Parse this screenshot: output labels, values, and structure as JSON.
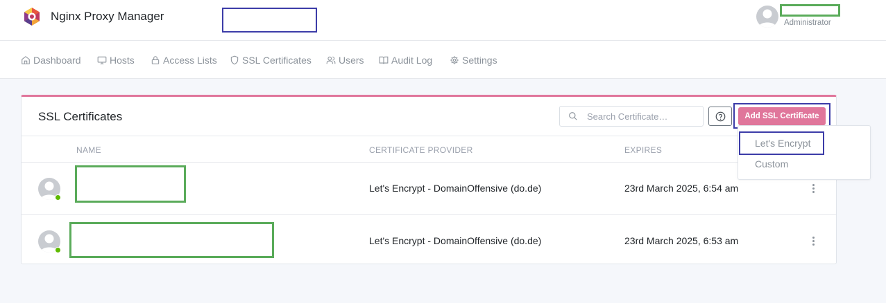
{
  "app": {
    "title": "Nginx Proxy Manager",
    "user_role": "Administrator"
  },
  "nav": [
    {
      "label": "Dashboard",
      "icon": "home-icon"
    },
    {
      "label": "Hosts",
      "icon": "monitor-icon"
    },
    {
      "label": "Access Lists",
      "icon": "lock-icon"
    },
    {
      "label": "SSL Certificates",
      "icon": "shield-icon"
    },
    {
      "label": "Users",
      "icon": "users-icon"
    },
    {
      "label": "Audit Log",
      "icon": "book-icon"
    },
    {
      "label": "Settings",
      "icon": "gear-icon"
    }
  ],
  "card": {
    "title": "SSL Certificates",
    "search_placeholder": "Search Certificate…",
    "add_button": "Add SSL Certificate"
  },
  "table": {
    "columns": [
      "NAME",
      "CERTIFICATE PROVIDER",
      "EXPIRES"
    ],
    "rows": [
      {
        "provider": "Let's Encrypt - DomainOffensive (do.de)",
        "expires": "23rd March 2025, 6:54 am"
      },
      {
        "provider": "Let's Encrypt - DomainOffensive (do.de)",
        "expires": "23rd March 2025, 6:53 am"
      }
    ]
  },
  "dropdown": {
    "items": [
      "Let's Encrypt",
      "Custom"
    ]
  },
  "colors": {
    "accent": "#e0769b",
    "annotation_redaction": "#5aab5a",
    "annotation_highlight": "#3c3ca8",
    "status_online": "#5eba00"
  }
}
